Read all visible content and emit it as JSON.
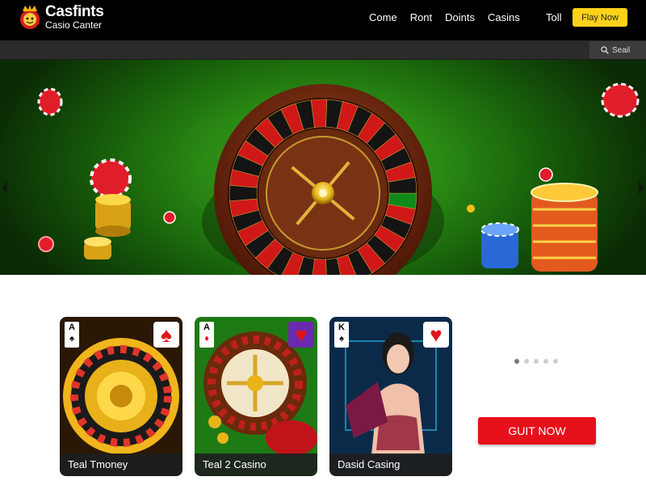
{
  "header": {
    "logo_title": "Casfints",
    "logo_subtitle": "Casio Canter",
    "nav": [
      "Come",
      "Ront",
      "Doints",
      "Casins"
    ],
    "extra_link": "Toll",
    "play_button": "Flay Now"
  },
  "subbar": {
    "search_label": "Seail"
  },
  "cards": [
    {
      "label": "Teal Tmoney",
      "corner_rank": "A",
      "corner_suit": "♠",
      "badge_suit": "♠"
    },
    {
      "label": "Teal 2 Casino",
      "corner_rank": "A",
      "corner_suit": "♦",
      "badge_suit": "♥"
    },
    {
      "label": "Dasid Casing",
      "corner_rank": "K",
      "corner_suit": "♠",
      "badge_suit": "♥"
    }
  ],
  "carousel": {
    "dot_count": 5,
    "active_index": 0
  },
  "cta": {
    "label": "GUIT NOW"
  },
  "colors": {
    "accent_yellow": "#ffd21a",
    "cta_red": "#e6101a",
    "header_bg": "#000000",
    "hero_green": "#2a8a14"
  },
  "icons": [
    "crown-logo-icon",
    "search-icon",
    "roulette-wheel-icon",
    "casino-chip-icon",
    "spade-icon",
    "heart-icon"
  ]
}
